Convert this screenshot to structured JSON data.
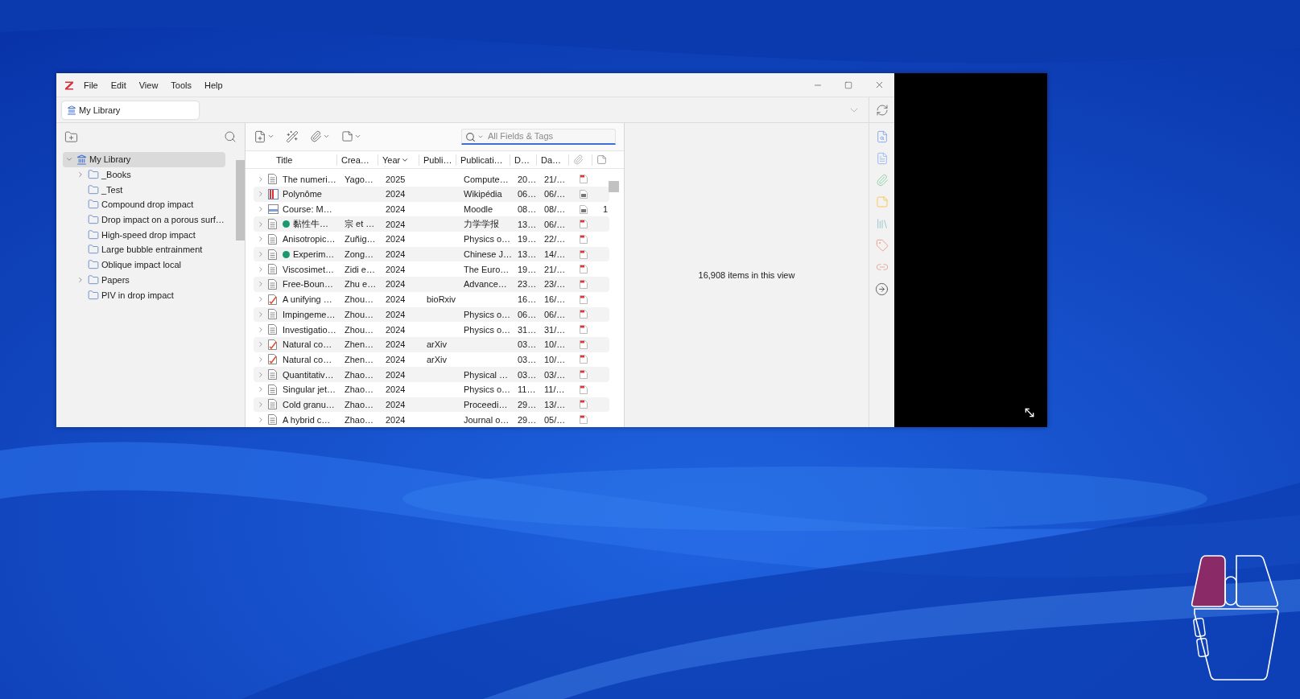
{
  "window": {
    "menu": [
      "File",
      "Edit",
      "View",
      "Tools",
      "Help"
    ]
  },
  "library_selector": {
    "label": "My Library"
  },
  "collections": [
    {
      "label": "My Library",
      "kind": "library",
      "selected": true,
      "expanded": true,
      "children": [
        {
          "label": "_Books",
          "kind": "folder",
          "selected": false,
          "expanded": false
        },
        {
          "label": "_Test",
          "kind": "folder",
          "selected": false
        },
        {
          "label": "Compound drop impact",
          "kind": "folder",
          "selected": false
        },
        {
          "label": "Drop impact on a porous surf…",
          "kind": "folder",
          "selected": false
        },
        {
          "label": "High-speed drop impact",
          "kind": "folder",
          "selected": false
        },
        {
          "label": "Large bubble entrainment",
          "kind": "folder",
          "selected": false
        },
        {
          "label": "Oblique impact local",
          "kind": "folder",
          "selected": false
        },
        {
          "label": "Papers",
          "kind": "folder",
          "selected": false,
          "expanded": false
        },
        {
          "label": "PIV in drop impact",
          "kind": "folder",
          "selected": false
        }
      ]
    }
  ],
  "search": {
    "placeholder": "All Fields & Tags"
  },
  "table": {
    "columns": [
      {
        "kind": "text",
        "label": "Title",
        "sorted": false
      },
      {
        "kind": "text",
        "label": "Crea…",
        "sorted": false
      },
      {
        "kind": "text",
        "label": "Year",
        "sorted": true
      },
      {
        "kind": "text",
        "label": "Publi…",
        "sorted": false
      },
      {
        "kind": "text",
        "label": "Publicati…",
        "sorted": false
      },
      {
        "kind": "text",
        "label": "D…",
        "sorted": false
      },
      {
        "kind": "text",
        "label": "Da…",
        "sorted": false
      },
      {
        "kind": "attachments",
        "sorted": false
      },
      {
        "kind": "notes",
        "sorted": false
      }
    ],
    "rows": [
      {
        "expanded": false,
        "kind": "document",
        "title": "The numeri…",
        "creator": "Yago…",
        "year": "2025",
        "publication": "Compute…",
        "date": "20…",
        "date_added": "21/…",
        "attachment": {
          "kind": "pdf"
        }
      },
      {
        "expanded": false,
        "kind": "encyclopedia",
        "title": "Polynôme",
        "year": "2024",
        "publication": "Wikipédia",
        "date": "06…",
        "date_added": "06/…",
        "attachment": {
          "kind": "snapshot"
        }
      },
      {
        "expanded": false,
        "kind": "webpage",
        "title": "Course: M…",
        "year": "2024",
        "publication": "Moodle",
        "date": "08…",
        "date_added": "08/…",
        "attachment": {
          "kind": "snapshot"
        },
        "notes": "1"
      },
      {
        "expanded": false,
        "kind": "document",
        "color": "#1a9a6c",
        "title": "黏性牛…",
        "creator": "宗 et …",
        "year": "2024",
        "publication": "力学学报",
        "date": "13…",
        "date_added": "06/…",
        "attachment": {
          "kind": "pdf"
        }
      },
      {
        "expanded": false,
        "kind": "document",
        "title": "Anisotropic…",
        "creator": "Zuñig…",
        "year": "2024",
        "publication": "Physics o…",
        "date": "19…",
        "date_added": "22/…",
        "attachment": {
          "kind": "pdf"
        }
      },
      {
        "expanded": false,
        "kind": "document",
        "color": "#1a9a6c",
        "title": "Experim…",
        "creator": "Zong…",
        "year": "2024",
        "publication": "Chinese J…",
        "date": "13…",
        "date_added": "14/…",
        "attachment": {
          "kind": "pdf"
        }
      },
      {
        "expanded": false,
        "kind": "document",
        "title": "Viscosimet…",
        "creator": "Zidi e…",
        "year": "2024",
        "publication": "The Euro…",
        "date": "19…",
        "date_added": "21/…",
        "attachment": {
          "kind": "pdf"
        }
      },
      {
        "expanded": false,
        "kind": "document",
        "title": "Free-Boun…",
        "creator": "Zhu e…",
        "year": "2024",
        "publication": "Advance…",
        "date": "23…",
        "date_added": "23/…",
        "attachment": {
          "kind": "pdf"
        }
      },
      {
        "expanded": false,
        "kind": "preprint",
        "title": "A unifying …",
        "creator": "Zhou…",
        "year": "2024",
        "publisher": "bioRxiv",
        "date": "16…",
        "date_added": "16/…",
        "attachment": {
          "kind": "pdf"
        }
      },
      {
        "expanded": false,
        "kind": "document",
        "title": "Impingeme…",
        "creator": "Zhou…",
        "year": "2024",
        "publication": "Physics o…",
        "date": "06…",
        "date_added": "06/…",
        "attachment": {
          "kind": "pdf"
        }
      },
      {
        "expanded": false,
        "kind": "document",
        "title": "Investigatio…",
        "creator": "Zhou…",
        "year": "2024",
        "publication": "Physics o…",
        "date": "31…",
        "date_added": "31/…",
        "attachment": {
          "kind": "pdf"
        }
      },
      {
        "expanded": false,
        "kind": "preprint",
        "title": "Natural co…",
        "creator": "Zhen…",
        "year": "2024",
        "publisher": "arXiv",
        "date": "03…",
        "date_added": "10/…",
        "attachment": {
          "kind": "pdf"
        }
      },
      {
        "expanded": false,
        "kind": "preprint",
        "title": "Natural co…",
        "creator": "Zhen…",
        "year": "2024",
        "publisher": "arXiv",
        "date": "03…",
        "date_added": "10/…",
        "attachment": {
          "kind": "pdf"
        }
      },
      {
        "expanded": false,
        "kind": "document",
        "title": "Quantitativ…",
        "creator": "Zhao…",
        "year": "2024",
        "publication": "Physical …",
        "date": "03…",
        "date_added": "03/…",
        "attachment": {
          "kind": "pdf"
        }
      },
      {
        "expanded": false,
        "kind": "document",
        "title": "Singular jet…",
        "creator": "Zhao…",
        "year": "2024",
        "publication": "Physics o…",
        "date": "11…",
        "date_added": "11/…",
        "attachment": {
          "kind": "pdf"
        }
      },
      {
        "expanded": false,
        "kind": "document",
        "title": "Cold granu…",
        "creator": "Zhao…",
        "year": "2024",
        "publication": "Proceedi…",
        "date": "29…",
        "date_added": "13/…",
        "attachment": {
          "kind": "pdf"
        }
      },
      {
        "expanded": false,
        "kind": "document",
        "title": "A hybrid c…",
        "creator": "Zhao…",
        "year": "2024",
        "publication": "Journal o…",
        "date": "29…",
        "date_added": "05/…",
        "attachment": {
          "kind": "pdf"
        }
      }
    ]
  },
  "item_pane": {
    "status": "16,908 items in this view"
  }
}
